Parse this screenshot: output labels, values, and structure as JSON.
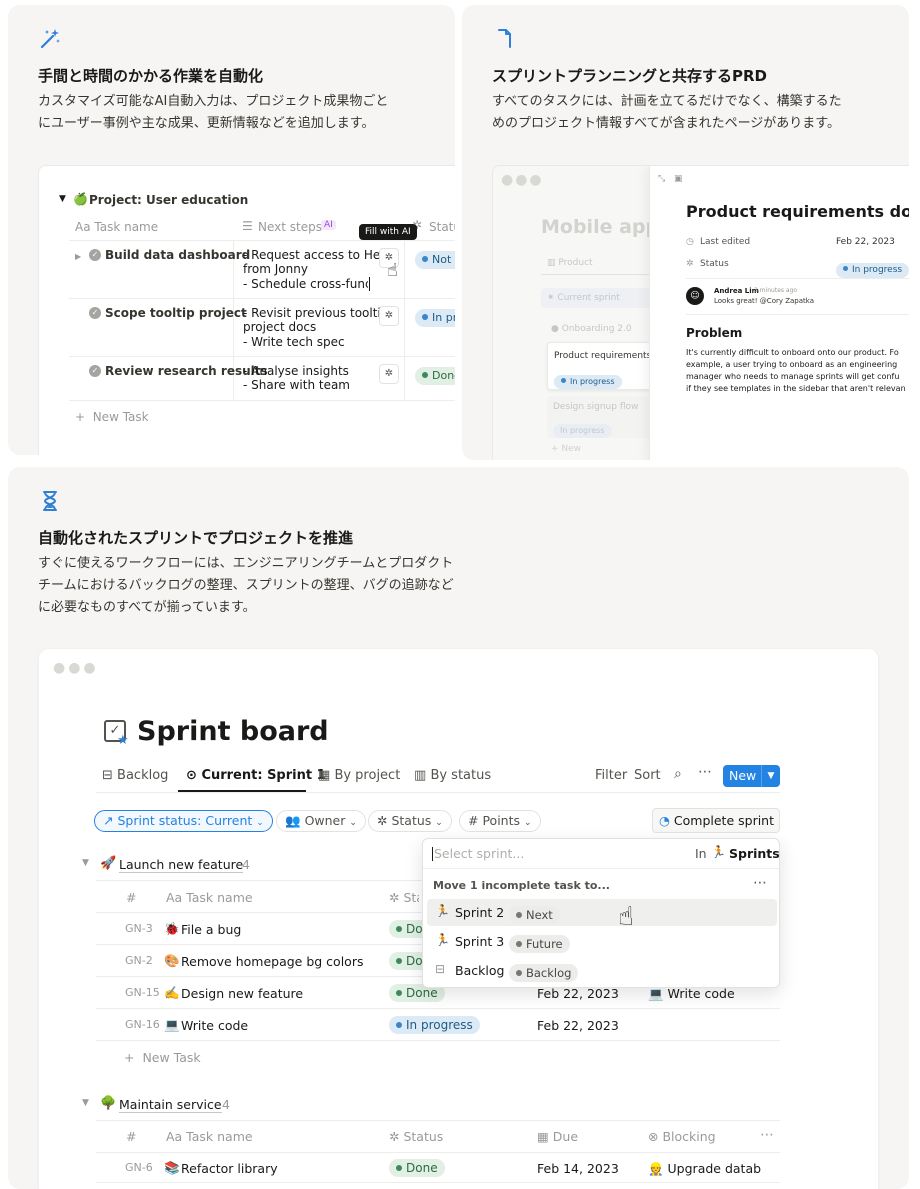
{
  "feature1": {
    "icon": "magic-wand-icon",
    "title": "手間と時間のかかる作業を自動化",
    "desc_line1": "カスタマイズ可能なAI自動入力は、プロジェクト成果物ごと",
    "desc_line2": "にユーザー事例や主な成果、更新情報などを追加します。",
    "mock": {
      "project_title": "Project: User education",
      "col_task": "Aa Task name",
      "col_next": "Next steps",
      "col_next_badge": "AI",
      "col_status": "Status",
      "tooltip": "Fill with AI",
      "rows": [
        {
          "task": "Build data dashboard",
          "steps": [
            "- Request access to Hex",
            "from Jonny",
            "- Schedule cross-func"
          ],
          "status": "Not s"
        },
        {
          "task": "Scope tooltip project",
          "steps": [
            "- Revisit previous tooltip",
            "project docs",
            "- Write tech spec"
          ],
          "status": "In pro"
        },
        {
          "task": "Review research results",
          "steps": [
            "- Analyse insights",
            "- Share with team"
          ],
          "status": "Done"
        }
      ],
      "new_task": "New Task"
    }
  },
  "feature2": {
    "icon": "document-corner-icon",
    "title": "スプリントプランニングと共存するPRD",
    "desc_line1": "すべてのタスクには、計画を立てるだけでなく、構築するた",
    "desc_line2": "めのプロジェクト情報すべてが含まれたページがあります。",
    "mock": {
      "bg_title": "Mobile app",
      "bg_tab": "Product",
      "bg_current": "Current sprint",
      "bg_group": "Onboarding 2.0",
      "bg_card_title": "Product requirements d",
      "bg_card_status": "In progress",
      "bg_card2_title": "Design signup flow",
      "bg_card2_status": "In progress",
      "bg_new": "New",
      "doc_title": "Product requirements doc",
      "last_edited_label": "Last edited",
      "last_edited_value": "Feb 22, 2023",
      "status_label": "Status",
      "status_value": "In progress",
      "comment_author": "Andrea Lim",
      "comment_time": "3 minutes ago",
      "comment_text": "Looks great! @Cory Zapatka",
      "problem_heading": "Problem",
      "problem_lines": [
        "It's currently difficult to onboard onto our product. Fo",
        "example, a user trying to onboard as an engineering",
        "manager who needs to manage sprints will get confu",
        "if they see templates in the sidebar that aren't relevan"
      ]
    }
  },
  "feature3": {
    "icon": "hourglass-icon",
    "title": "自動化されたスプリントでプロジェクトを推進",
    "desc_line1": "すぐに使えるワークフローには、エンジニアリングチームとプロダクト",
    "desc_line2": "チームにおけるバックログの整理、スプリントの整理、バグの追跡など",
    "desc_line3": "に必要なものすべてが揃っています。",
    "board": {
      "title": "Sprint board",
      "tabs": [
        "Backlog",
        "Current: Sprint 1",
        "By project",
        "By status"
      ],
      "filter": "Filter",
      "sort": "Sort",
      "new_button": "New",
      "chips": [
        "Sprint status: Current",
        "Owner",
        "Status",
        "Points"
      ],
      "complete_sprint": "Complete sprint",
      "group1": {
        "name": "Launch new feature",
        "count": "4"
      },
      "group2": {
        "name": "Maintain service",
        "count": "4"
      },
      "col_hash": "#",
      "col_task": "Aa Task name",
      "col_status": "Status",
      "col_due": "Due",
      "col_blocking": "Blocking",
      "col_status_trunc": "Sta",
      "rows1": [
        {
          "id": "GN-3",
          "emoji": "🐞",
          "task": "File a bug",
          "status": "Dor",
          "date": "",
          "block": ""
        },
        {
          "id": "GN-2",
          "emoji": "🎨",
          "task": "Remove homepage bg colors",
          "status": "Dor",
          "date": "",
          "block": ""
        },
        {
          "id": "GN-15",
          "emoji": "✍️",
          "task": "Design new feature",
          "status": "Done",
          "date": "Feb 22, 2023",
          "block": "💻 Write code"
        },
        {
          "id": "GN-16",
          "emoji": "💻",
          "task": "Write code",
          "status": "In progress",
          "date": "Feb 22, 2023",
          "block": ""
        }
      ],
      "rows2": [
        {
          "id": "GN-6",
          "emoji": "📚",
          "task": "Refactor library",
          "status": "Done",
          "date": "Feb 14, 2023",
          "block": "👷 Upgrade datab"
        }
      ],
      "new_task": "New Task",
      "dropdown": {
        "placeholder": "Select sprint...",
        "in_label": "In",
        "in_db": "Sprints",
        "section": "Move 1 incomplete task to...",
        "options": [
          {
            "name": "Sprint 2",
            "tag": "Next"
          },
          {
            "name": "Sprint 3",
            "tag": "Future"
          },
          {
            "name": "Backlog",
            "tag": "Backlog"
          }
        ]
      }
    }
  }
}
